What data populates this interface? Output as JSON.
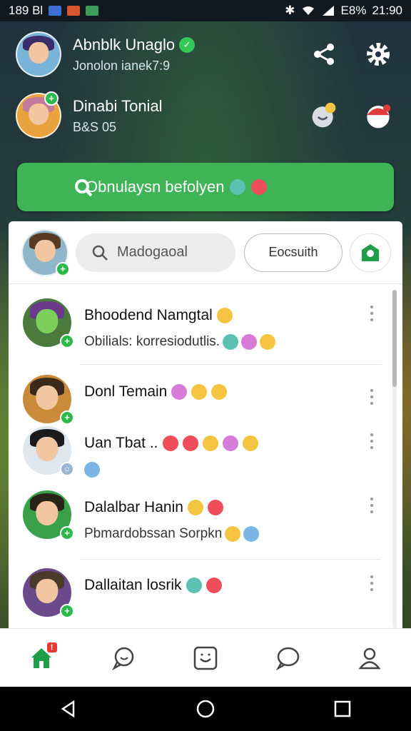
{
  "status_bar": {
    "time_left": "189 Bl",
    "battery": "E8%",
    "clock": "21:90"
  },
  "accounts": [
    {
      "name": "Abnblk Unaglo",
      "sub": "Jonolon ianek7:9",
      "verified": true
    },
    {
      "name": "Dinabi Tonial",
      "sub": "B&S 05"
    }
  ],
  "banner": {
    "label": "Obnulaysn befolyen"
  },
  "toolbar": {
    "search_label": "Madogaoal",
    "desc_label": "Eocsuith"
  },
  "chats": [
    {
      "name": "Bhoodend Namgtal",
      "message": "Obilials: korresiodutlis."
    },
    {
      "name": "Donl Temain",
      "message": ""
    },
    {
      "name": "Uan Tbat ..",
      "message": ""
    },
    {
      "name": "Dalalbar Hanin",
      "message": "Pbmardobssan Sorpkn"
    },
    {
      "name": "Dallaitan  losrik",
      "message": ""
    }
  ],
  "tabs": [
    "home",
    "chat",
    "smiley",
    "message",
    "profile"
  ],
  "colors": {
    "accent_green": "#3fb456",
    "badge_red": "#e53935"
  }
}
